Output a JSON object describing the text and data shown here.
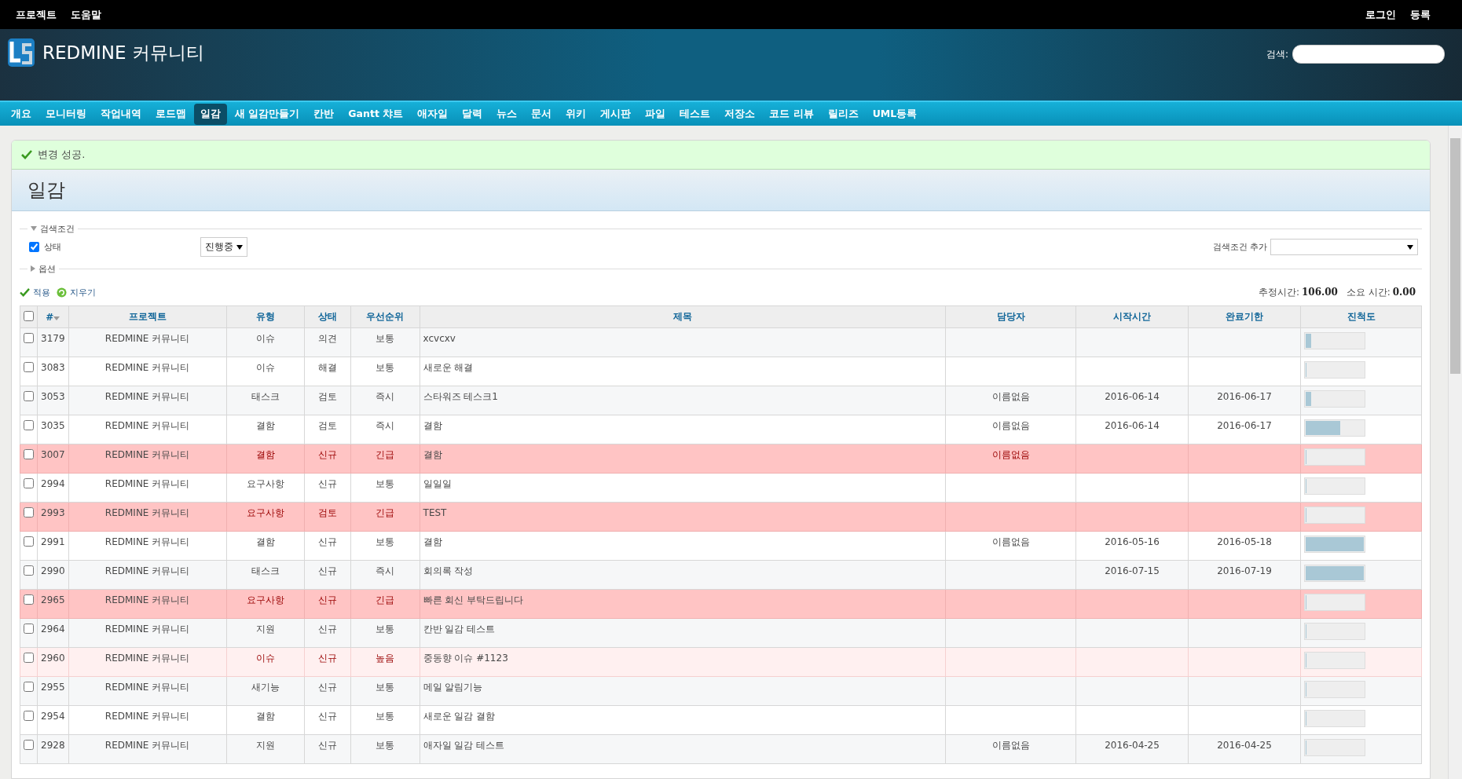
{
  "top_menu": [
    "프로젝트",
    "도움말"
  ],
  "account_menu": [
    "로그인",
    "등록"
  ],
  "header": {
    "title": "REDMINE 커뮤니티",
    "search_label": "검색:"
  },
  "tabs": [
    {
      "label": "개요",
      "selected": false
    },
    {
      "label": "모니터링",
      "selected": false
    },
    {
      "label": "작업내역",
      "selected": false
    },
    {
      "label": "로드맵",
      "selected": false
    },
    {
      "label": "일감",
      "selected": true
    },
    {
      "label": "새 일감만들기",
      "selected": false
    },
    {
      "label": "칸반",
      "selected": false
    },
    {
      "label": "Gantt 챠트",
      "selected": false
    },
    {
      "label": "애자일",
      "selected": false
    },
    {
      "label": "달력",
      "selected": false
    },
    {
      "label": "뉴스",
      "selected": false
    },
    {
      "label": "문서",
      "selected": false
    },
    {
      "label": "위키",
      "selected": false
    },
    {
      "label": "게시판",
      "selected": false
    },
    {
      "label": "파일",
      "selected": false
    },
    {
      "label": "테스트",
      "selected": false
    },
    {
      "label": "저장소",
      "selected": false
    },
    {
      "label": "코드 리뷰",
      "selected": false
    },
    {
      "label": "릴리즈",
      "selected": false
    },
    {
      "label": "UML등록",
      "selected": false
    }
  ],
  "flash": "변경 성공.",
  "page_title": "일감",
  "filters": {
    "legend": "검색조건",
    "expanded": true,
    "status_label": "상태",
    "status_checked": true,
    "status_value": "진행중",
    "add_filter_label": "검색조건 추가"
  },
  "options": {
    "legend": "옵션",
    "expanded": false
  },
  "actions": [
    {
      "kind": "apply",
      "label": "적용"
    },
    {
      "kind": "clear",
      "label": "지우기"
    }
  ],
  "totals": [
    {
      "label": "추정시간:",
      "value": "106.00"
    },
    {
      "label": "소요 시간:",
      "value": "0.00"
    }
  ],
  "table": {
    "all_checked": false,
    "columns": [
      {
        "label": "#",
        "sorted": true
      },
      {
        "label": "프로젝트",
        "sorted": false
      },
      {
        "label": "유형",
        "sorted": false
      },
      {
        "label": "상태",
        "sorted": false
      },
      {
        "label": "우선순위",
        "sorted": false
      },
      {
        "label": "제목",
        "sorted": false
      },
      {
        "label": "담당자",
        "sorted": false
      },
      {
        "label": "시작시간",
        "sorted": false
      },
      {
        "label": "완료기한",
        "sorted": false
      },
      {
        "label": "진척도",
        "sorted": false
      }
    ],
    "rows": [
      {
        "id": "3179",
        "project": "REDMINE 커뮤니티",
        "type": "이슈",
        "status": "의견",
        "priority": "보통",
        "subject": "xcvcxv",
        "assignee": "",
        "start": "",
        "due": "",
        "level": 0.1,
        "kind": "normal",
        "checked": false
      },
      {
        "id": "3083",
        "project": "REDMINE 커뮤니티",
        "type": "이슈",
        "status": "해결",
        "priority": "보통",
        "subject": "새로운 해결",
        "assignee": "",
        "start": "",
        "due": "",
        "level": 0,
        "kind": "normal",
        "checked": false
      },
      {
        "id": "3053",
        "project": "REDMINE 커뮤니티",
        "type": "태스크",
        "status": "검토",
        "priority": "즉시",
        "subject": "스타워즈 테스크1",
        "assignee": "이름없음",
        "start": "2016-06-14",
        "due": "2016-06-17",
        "level": 0.1,
        "kind": "normal",
        "checked": false
      },
      {
        "id": "3035",
        "project": "REDMINE 커뮤니티",
        "type": "결함",
        "status": "검토",
        "priority": "즉시",
        "subject": "결함",
        "assignee": "이름없음",
        "start": "2016-06-14",
        "due": "2016-06-17",
        "level": 0.6,
        "kind": "normal",
        "checked": false
      },
      {
        "id": "3007",
        "project": "REDMINE 커뮤니티",
        "type": "결함",
        "status": "신규",
        "priority": "긴급",
        "subject": "결함",
        "assignee": "이름없음",
        "start": "",
        "due": "",
        "level": 0,
        "kind": "urgent",
        "checked": false
      },
      {
        "id": "2994",
        "project": "REDMINE 커뮤니티",
        "type": "요구사항",
        "status": "신규",
        "priority": "보통",
        "subject": "일일일",
        "assignee": "",
        "start": "",
        "due": "",
        "level": 0,
        "kind": "normal",
        "checked": false
      },
      {
        "id": "2993",
        "project": "REDMINE 커뮤니티",
        "type": "요구사항",
        "status": "검토",
        "priority": "긴급",
        "subject": "TEST",
        "assignee": "",
        "start": "",
        "due": "",
        "level": 0,
        "kind": "urgent",
        "checked": false
      },
      {
        "id": "2991",
        "project": "REDMINE 커뮤니티",
        "type": "결함",
        "status": "신규",
        "priority": "보통",
        "subject": "결함",
        "assignee": "이름없음",
        "start": "2016-05-16",
        "due": "2016-05-18",
        "level": 1,
        "kind": "normal",
        "checked": false
      },
      {
        "id": "2990",
        "project": "REDMINE 커뮤니티",
        "type": "태스크",
        "status": "신규",
        "priority": "즉시",
        "subject": "회의록 작성",
        "assignee": "",
        "start": "2016-07-15",
        "due": "2016-07-19",
        "level": 1,
        "kind": "normal",
        "checked": false
      },
      {
        "id": "2965",
        "project": "REDMINE 커뮤니티",
        "type": "요구사항",
        "status": "신규",
        "priority": "긴급",
        "subject": "빠른 회신 부탁드립니다",
        "assignee": "",
        "start": "",
        "due": "",
        "level": 0,
        "kind": "urgent",
        "checked": false
      },
      {
        "id": "2964",
        "project": "REDMINE 커뮤니티",
        "type": "지원",
        "status": "신규",
        "priority": "보통",
        "subject": "칸반 일감 테스트",
        "assignee": "",
        "start": "",
        "due": "",
        "level": 0,
        "kind": "normal",
        "checked": false
      },
      {
        "id": "2960",
        "project": "REDMINE 커뮤니티",
        "type": "이슈",
        "status": "신규",
        "priority": "높음",
        "subject": "중동향 이슈 #1123",
        "assignee": "",
        "start": "",
        "due": "",
        "level": 0,
        "kind": "high",
        "checked": false
      },
      {
        "id": "2955",
        "project": "REDMINE 커뮤니티",
        "type": "새기능",
        "status": "신규",
        "priority": "보통",
        "subject": "메일 알림기능",
        "assignee": "",
        "start": "",
        "due": "",
        "level": 0,
        "kind": "normal",
        "checked": false
      },
      {
        "id": "2954",
        "project": "REDMINE 커뮤니티",
        "type": "결함",
        "status": "신규",
        "priority": "보통",
        "subject": "새로운 일감 결함",
        "assignee": "",
        "start": "",
        "due": "",
        "level": 0,
        "kind": "normal",
        "checked": false
      },
      {
        "id": "2928",
        "project": "REDMINE 커뮤니티",
        "type": "지원",
        "status": "신규",
        "priority": "보통",
        "subject": "애자일 일감 테스트",
        "assignee": "이름없음",
        "start": "2016-04-25",
        "due": "2016-04-25",
        "level": 0,
        "kind": "normal",
        "checked": false
      }
    ]
  }
}
